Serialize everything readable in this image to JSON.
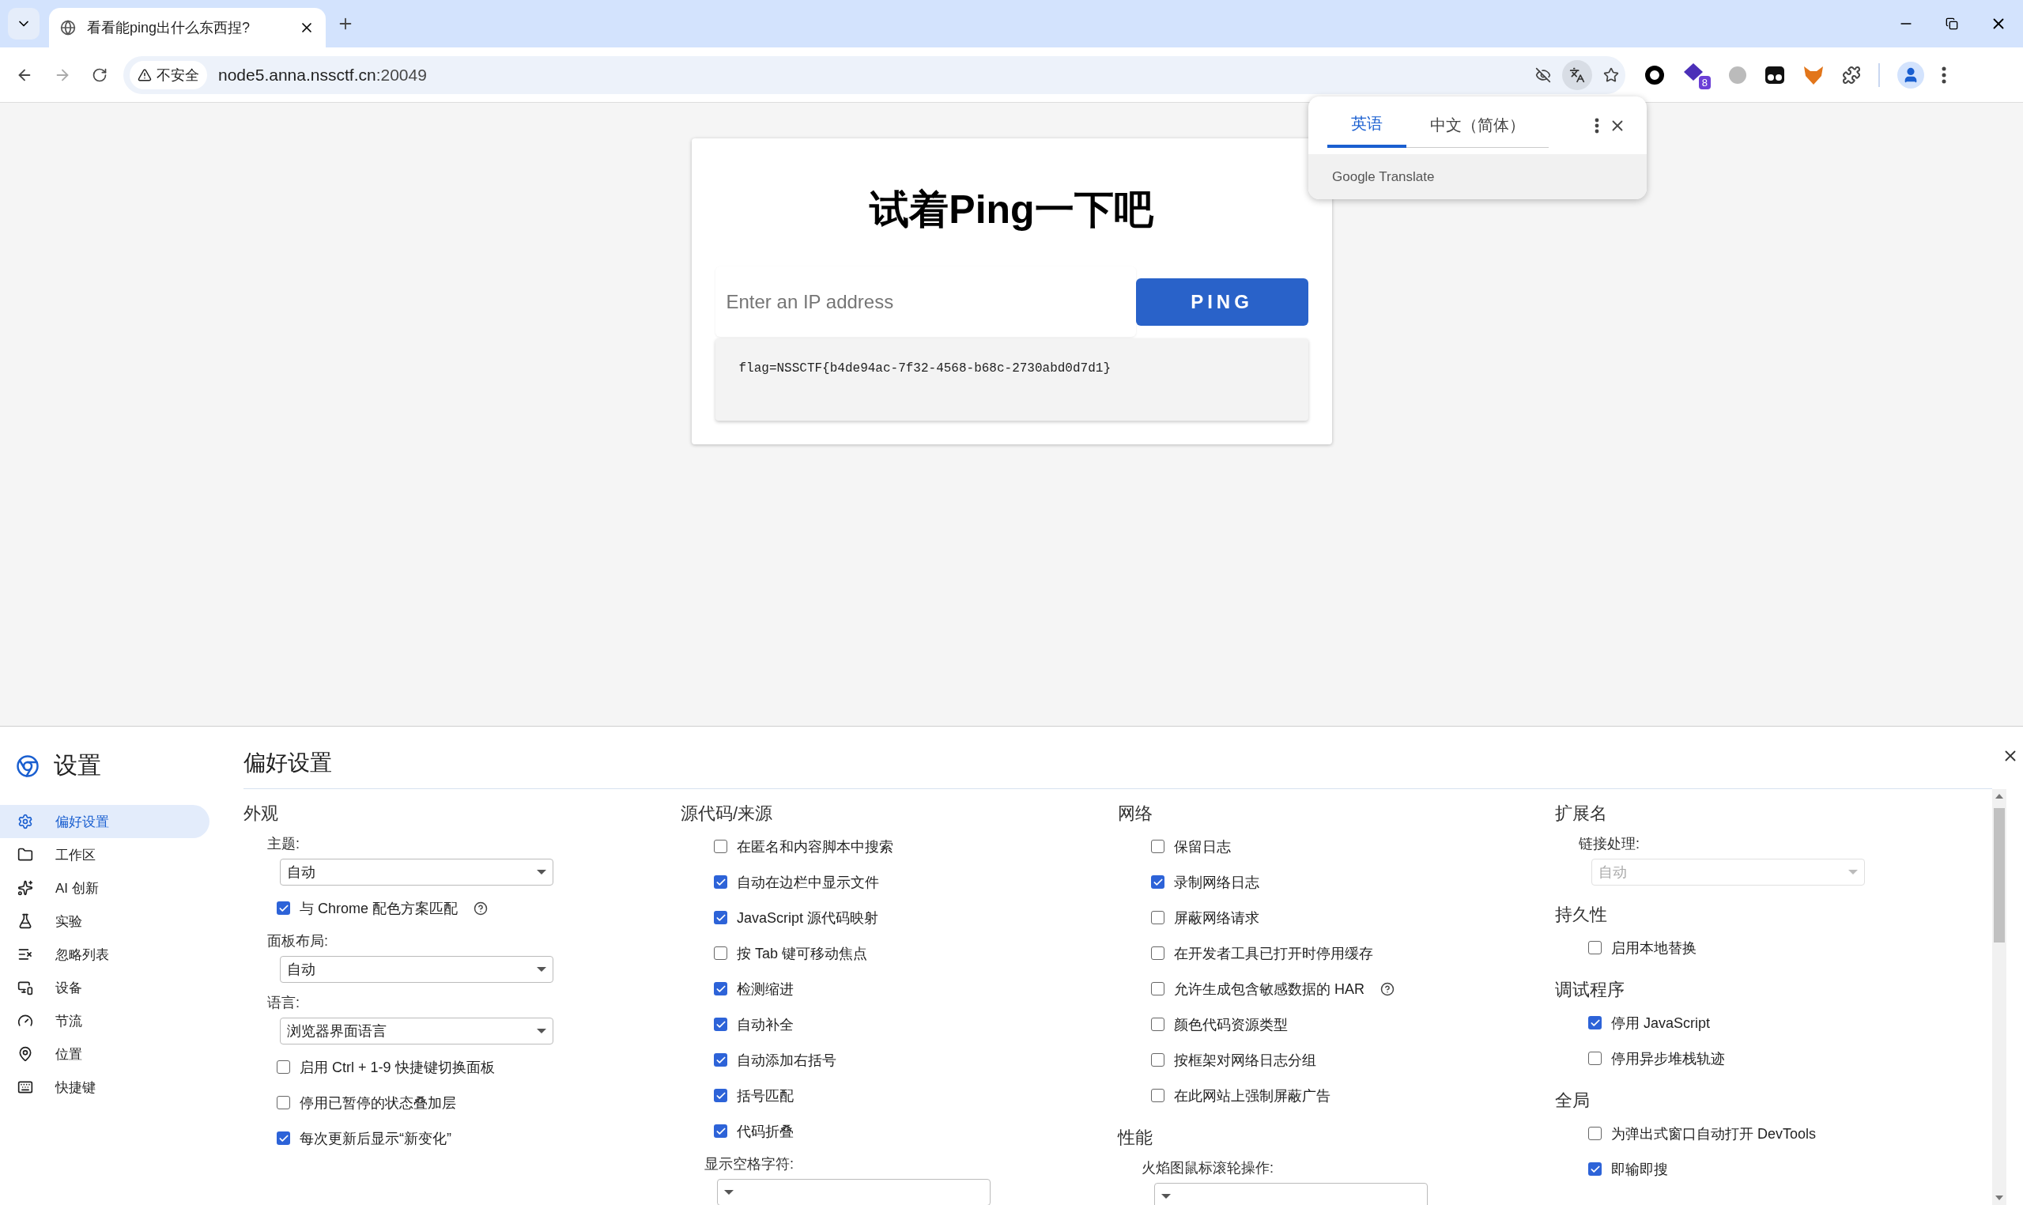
{
  "browser": {
    "tabs": [
      {
        "title": "看看能ping出什么东西捏?",
        "selected": true
      }
    ],
    "address": {
      "security_label": "不安全",
      "url_host": "node5.anna.nssctf.cn",
      "url_port": ":20049"
    },
    "extension_badge": "8"
  },
  "page": {
    "title": "试着Ping一下吧",
    "input": {
      "placeholder": "Enter an IP address"
    },
    "button": "PING",
    "output": "flag=NSSCTF{b4de94ac-7f32-4568-b68c-2730abd0d7d1}"
  },
  "translate_popup": {
    "tabs": [
      {
        "label": "英语",
        "selected": true
      },
      {
        "label": "中文（简体）",
        "selected": false
      }
    ],
    "brand": "Google Translate"
  },
  "devtools": {
    "title": "设置",
    "nav": [
      {
        "label": "偏好设置",
        "selected": true
      },
      {
        "label": "工作区",
        "selected": false
      },
      {
        "label": "AI 创新",
        "selected": false
      },
      {
        "label": "实验",
        "selected": false
      },
      {
        "label": "忽略列表",
        "selected": false
      },
      {
        "label": "设备",
        "selected": false
      },
      {
        "label": "节流",
        "selected": false
      },
      {
        "label": "位置",
        "selected": false
      },
      {
        "label": "快捷键",
        "selected": false
      }
    ],
    "panel_title": "偏好设置",
    "columns": [
      [
        {
          "heading": "外观",
          "items": [
            {
              "kind": "select",
              "label": "主题:",
              "value": "自动",
              "disabled": false
            },
            {
              "kind": "checkbox",
              "label": "与 Chrome 配色方案匹配",
              "checked": true,
              "help": true
            },
            {
              "kind": "select",
              "label": "面板布局:",
              "value": "自动",
              "disabled": false
            },
            {
              "kind": "select",
              "label": "语言:",
              "value": "浏览器界面语言",
              "disabled": false
            },
            {
              "kind": "checkbox",
              "label": "启用 Ctrl + 1-9 快捷键切换面板",
              "checked": false,
              "help": false
            },
            {
              "kind": "checkbox",
              "label": "停用已暂停的状态叠加层",
              "checked": false,
              "help": false
            },
            {
              "kind": "checkbox",
              "label": "每次更新后显示“新变化”",
              "checked": true,
              "help": false
            }
          ]
        }
      ],
      [
        {
          "heading": "源代码/来源",
          "items": [
            {
              "kind": "checkbox",
              "label": "在匿名和内容脚本中搜索",
              "checked": false,
              "help": false
            },
            {
              "kind": "checkbox",
              "label": "自动在边栏中显示文件",
              "checked": true,
              "help": false
            },
            {
              "kind": "checkbox",
              "label": "JavaScript 源代码映射",
              "checked": true,
              "help": false
            },
            {
              "kind": "checkbox",
              "label": "按 Tab 键可移动焦点",
              "checked": false,
              "help": false
            },
            {
              "kind": "checkbox",
              "label": "检测缩进",
              "checked": true,
              "help": false
            },
            {
              "kind": "checkbox",
              "label": "自动补全",
              "checked": true,
              "help": false
            },
            {
              "kind": "checkbox",
              "label": "自动添加右括号",
              "checked": true,
              "help": false
            },
            {
              "kind": "checkbox",
              "label": "括号匹配",
              "checked": true,
              "help": false
            },
            {
              "kind": "checkbox",
              "label": "代码折叠",
              "checked": true,
              "help": false
            },
            {
              "kind": "select",
              "label": "显示空格字符:",
              "disabled": false
            }
          ]
        }
      ],
      [
        {
          "heading": "网络",
          "items": [
            {
              "kind": "checkbox",
              "label": "保留日志",
              "checked": false,
              "help": false
            },
            {
              "kind": "checkbox",
              "label": "录制网络日志",
              "checked": true,
              "help": false
            },
            {
              "kind": "checkbox",
              "label": "屏蔽网络请求",
              "checked": false,
              "help": false
            },
            {
              "kind": "checkbox",
              "label": "在开发者工具已打开时停用缓存",
              "checked": false,
              "help": false
            },
            {
              "kind": "checkbox",
              "label": "允许生成包含敏感数据的 HAR",
              "checked": false,
              "help": true
            },
            {
              "kind": "checkbox",
              "label": "颜色代码资源类型",
              "checked": false,
              "help": false
            },
            {
              "kind": "checkbox",
              "label": "按框架对网络日志分组",
              "checked": false,
              "help": false
            },
            {
              "kind": "checkbox",
              "label": "在此网站上强制屏蔽广告",
              "checked": false,
              "help": false
            }
          ]
        },
        {
          "heading": "性能",
          "items": [
            {
              "kind": "select",
              "label": "火焰图鼠标滚轮操作:",
              "disabled": false
            }
          ]
        }
      ],
      [
        {
          "heading": "扩展名",
          "items": [
            {
              "kind": "select",
              "label": "链接处理:",
              "value": "自动",
              "disabled": true
            }
          ]
        },
        {
          "heading": "持久性",
          "items": [
            {
              "kind": "checkbox",
              "label": "启用本地替换",
              "checked": false,
              "help": false
            }
          ]
        },
        {
          "heading": "调试程序",
          "items": [
            {
              "kind": "checkbox",
              "label": "停用 JavaScript",
              "checked": true,
              "help": false
            },
            {
              "kind": "checkbox",
              "label": "停用异步堆栈轨迹",
              "checked": false,
              "help": false
            }
          ]
        },
        {
          "heading": "全局",
          "items": [
            {
              "kind": "checkbox",
              "label": "为弹出式窗口自动打开 DevTools",
              "checked": false,
              "help": false
            },
            {
              "kind": "checkbox",
              "label": "即输即搜",
              "checked": true,
              "help": false
            }
          ]
        }
      ]
    ]
  }
}
